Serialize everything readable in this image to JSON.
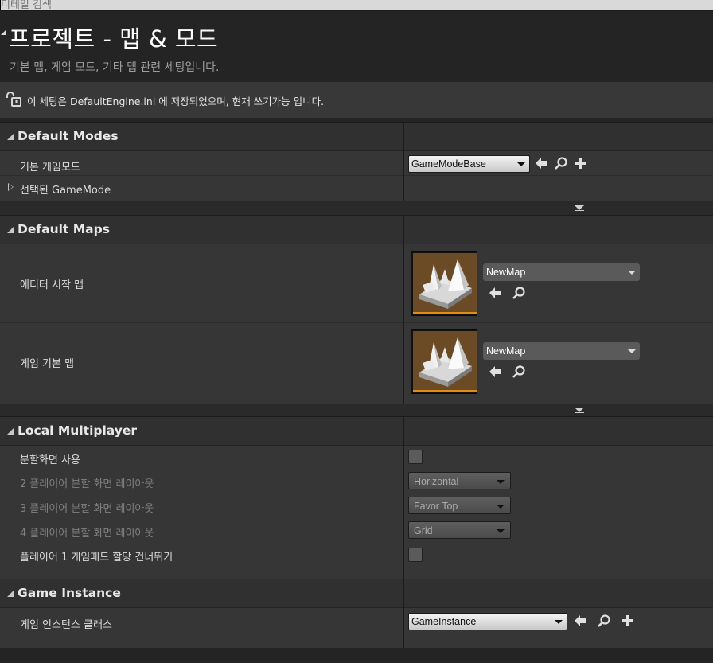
{
  "search": {
    "placeholder": "디테일 검색"
  },
  "page": {
    "title": "프로젝트 - 맵 & 모드",
    "description": "기본 맵, 게임 모드, 기타 맵 관련 세팅입니다.",
    "notice": "이 세팅은 DefaultEngine.ini 에 저장되었으며, 현재 쓰기가능 입니다."
  },
  "sections": {
    "default_modes": {
      "title": "Default Modes",
      "default_gamemode_label": "기본 게임모드",
      "default_gamemode_value": "GameModeBase",
      "selected_gamemode_label": "선택된 GameMode"
    },
    "default_maps": {
      "title": "Default Maps",
      "editor_startup_map_label": "에디터 시작 맵",
      "editor_startup_map_value": "NewMap",
      "game_default_map_label": "게임 기본 맵",
      "game_default_map_value": "NewMap"
    },
    "local_multiplayer": {
      "title": "Local Multiplayer",
      "use_splitscreen_label": "분할화면 사용",
      "use_splitscreen_checked": false,
      "two_player_label": "2 플레이어 분할 화면 레이아웃",
      "two_player_value": "Horizontal",
      "three_player_label": "3 플레이어 분할 화면 레이아웃",
      "three_player_value": "Favor Top",
      "four_player_label": "4 플레이어 분할 화면 레이아웃",
      "four_player_value": "Grid",
      "skip_gamepad_label": "플레이어 1 게임패드 할당 건너뛰기",
      "skip_gamepad_checked": false
    },
    "game_instance": {
      "title": "Game Instance",
      "class_label": "게임 인스턴스 클래스",
      "class_value": "GameInstance"
    }
  },
  "colors": {
    "background": "#242424",
    "section_header": "#303030",
    "row": "#363636",
    "thumbnail_accent": "#e58a12"
  }
}
